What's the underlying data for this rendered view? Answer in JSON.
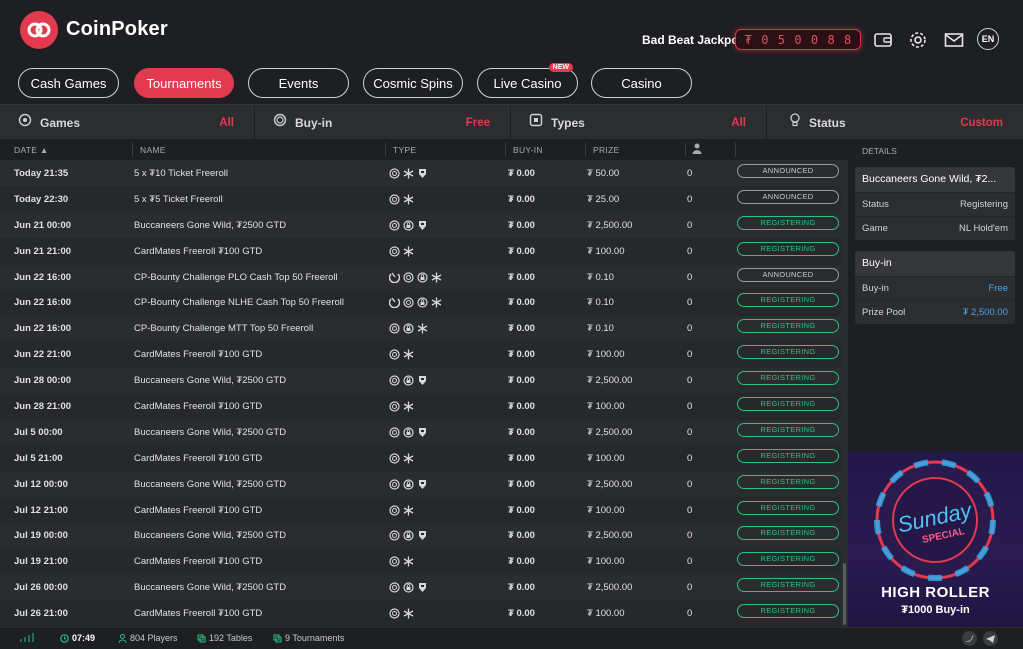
{
  "brand": {
    "name": "CoinPoker"
  },
  "header": {
    "jackpot_label": "Bad Beat Jackpot",
    "jackpot_digits": [
      "₮",
      "0",
      "5",
      "0",
      "0",
      "8",
      "8"
    ],
    "lang": "EN"
  },
  "tabs": [
    {
      "label": "Cash Games",
      "active": false
    },
    {
      "label": "Tournaments",
      "active": true
    },
    {
      "label": "Events",
      "active": false
    },
    {
      "label": "Cosmic Spins",
      "active": false
    },
    {
      "label": "Live Casino",
      "active": false,
      "badge": "NEW"
    },
    {
      "label": "Casino",
      "active": false
    }
  ],
  "filters": [
    {
      "label": "Games",
      "value": "All",
      "icon": "games-icon"
    },
    {
      "label": "Buy-in",
      "value": "Free",
      "icon": "buyin-icon"
    },
    {
      "label": "Types",
      "value": "All",
      "icon": "types-icon"
    },
    {
      "label": "Status",
      "value": "Custom",
      "icon": "bulb-icon"
    }
  ],
  "table": {
    "headers": {
      "date": "DATE",
      "name": "NAME",
      "type": "TYPE",
      "buyin": "BUY-IN",
      "prize": "PRIZE"
    },
    "rows": [
      {
        "date": "Today 21:35",
        "name": "5 x ₮10 Ticket Freeroll",
        "types": [
          "chip",
          "snow",
          "shield"
        ],
        "buyin": "₮ 0.00",
        "prize": "₮ 50.00",
        "players": "0",
        "status": "ANNOUNCED"
      },
      {
        "date": "Today 22:30",
        "name": "5 x ₮5 Ticket Freeroll",
        "types": [
          "chip",
          "snow"
        ],
        "buyin": "₮ 0.00",
        "prize": "₮ 25.00",
        "players": "0",
        "status": "ANNOUNCED"
      },
      {
        "date": "Jun 21 00:00",
        "name": "Buccaneers Gone Wild, ₮2500 GTD",
        "types": [
          "chip",
          "lock",
          "shield"
        ],
        "buyin": "₮ 0.00",
        "prize": "₮ 2,500.00",
        "players": "0",
        "status": "REGISTERING"
      },
      {
        "date": "Jun 21 21:00",
        "name": "CardMates Freeroll ₮100 GTD",
        "types": [
          "chip",
          "snow"
        ],
        "buyin": "₮ 0.00",
        "prize": "₮ 100.00",
        "players": "0",
        "status": "REGISTERING"
      },
      {
        "date": "Jun 22 16:00",
        "name": "CP-Bounty Challenge PLO Cash Top 50 Freeroll",
        "types": [
          "bounty",
          "chip",
          "lock",
          "snow"
        ],
        "buyin": "₮ 0.00",
        "prize": "₮ 0.10",
        "players": "0",
        "status": "ANNOUNCED"
      },
      {
        "date": "Jun 22 16:00",
        "name": "CP-Bounty Challenge NLHE Cash Top 50 Freeroll",
        "types": [
          "bounty",
          "chip",
          "lock",
          "snow"
        ],
        "buyin": "₮ 0.00",
        "prize": "₮ 0.10",
        "players": "0",
        "status": "REGISTERING"
      },
      {
        "date": "Jun 22 16:00",
        "name": "CP-Bounty Challenge MTT Top 50 Freeroll",
        "types": [
          "chip",
          "lock",
          "snow"
        ],
        "buyin": "₮ 0.00",
        "prize": "₮ 0.10",
        "players": "0",
        "status": "REGISTERING"
      },
      {
        "date": "Jun 22 21:00",
        "name": "CardMates Freeroll ₮100 GTD",
        "types": [
          "chip",
          "snow"
        ],
        "buyin": "₮ 0.00",
        "prize": "₮ 100.00",
        "players": "0",
        "status": "REGISTERING"
      },
      {
        "date": "Jun 28 00:00",
        "name": "Buccaneers Gone Wild, ₮2500 GTD",
        "types": [
          "chip",
          "lock",
          "shield"
        ],
        "buyin": "₮ 0.00",
        "prize": "₮ 2,500.00",
        "players": "0",
        "status": "REGISTERING"
      },
      {
        "date": "Jun 28 21:00",
        "name": "CardMates Freeroll ₮100 GTD",
        "types": [
          "chip",
          "snow"
        ],
        "buyin": "₮ 0.00",
        "prize": "₮ 100.00",
        "players": "0",
        "status": "REGISTERING"
      },
      {
        "date": "Jul 5 00:00",
        "name": "Buccaneers Gone Wild, ₮2500 GTD",
        "types": [
          "chip",
          "lock",
          "shield"
        ],
        "buyin": "₮ 0.00",
        "prize": "₮ 2,500.00",
        "players": "0",
        "status": "REGISTERING"
      },
      {
        "date": "Jul 5 21:00",
        "name": "CardMates Freeroll ₮100 GTD",
        "types": [
          "chip",
          "snow"
        ],
        "buyin": "₮ 0.00",
        "prize": "₮ 100.00",
        "players": "0",
        "status": "REGISTERING"
      },
      {
        "date": "Jul 12 00:00",
        "name": "Buccaneers Gone Wild, ₮2500 GTD",
        "types": [
          "chip",
          "lock",
          "shield"
        ],
        "buyin": "₮ 0.00",
        "prize": "₮ 2,500.00",
        "players": "0",
        "status": "REGISTERING"
      },
      {
        "date": "Jul 12 21:00",
        "name": "CardMates Freeroll ₮100 GTD",
        "types": [
          "chip",
          "snow"
        ],
        "buyin": "₮ 0.00",
        "prize": "₮ 100.00",
        "players": "0",
        "status": "REGISTERING"
      },
      {
        "date": "Jul 19 00:00",
        "name": "Buccaneers Gone Wild, ₮2500 GTD",
        "types": [
          "chip",
          "lock",
          "shield"
        ],
        "buyin": "₮ 0.00",
        "prize": "₮ 2,500.00",
        "players": "0",
        "status": "REGISTERING"
      },
      {
        "date": "Jul 19 21:00",
        "name": "CardMates Freeroll ₮100 GTD",
        "types": [
          "chip",
          "snow"
        ],
        "buyin": "₮ 0.00",
        "prize": "₮ 100.00",
        "players": "0",
        "status": "REGISTERING"
      },
      {
        "date": "Jul 26 00:00",
        "name": "Buccaneers Gone Wild, ₮2500 GTD",
        "types": [
          "chip",
          "lock",
          "shield"
        ],
        "buyin": "₮ 0.00",
        "prize": "₮ 2,500.00",
        "players": "0",
        "status": "REGISTERING"
      },
      {
        "date": "Jul 26 21:00",
        "name": "CardMates Freeroll ₮100 GTD",
        "types": [
          "chip",
          "snow"
        ],
        "buyin": "₮ 0.00",
        "prize": "₮ 100.00",
        "players": "0",
        "status": "REGISTERING"
      }
    ]
  },
  "details": {
    "heading": "DETAILS",
    "title": "Buccaneers Gone Wild, ₮2...",
    "status_label": "Status",
    "status_value": "Registering",
    "game_label": "Game",
    "game_value": "NL Hold'em",
    "buyin_section": "Buy-in",
    "buyin_label": "Buy-in",
    "buyin_value": "Free",
    "pool_label": "Prize Pool",
    "pool_value": "₮ 2,500.00"
  },
  "promo": {
    "line1": "Sunday",
    "line2": "SPECIAL",
    "title": "HIGH ROLLER",
    "subtitle": "₮1000 Buy-in"
  },
  "footer": {
    "time": "07:49",
    "players": "804 Players",
    "tables": "192 Tables",
    "tournaments": "9 Tournaments"
  },
  "colors": {
    "accent": "#e23a4f",
    "registering": "#2ec27e",
    "link": "#4aa3e8"
  }
}
